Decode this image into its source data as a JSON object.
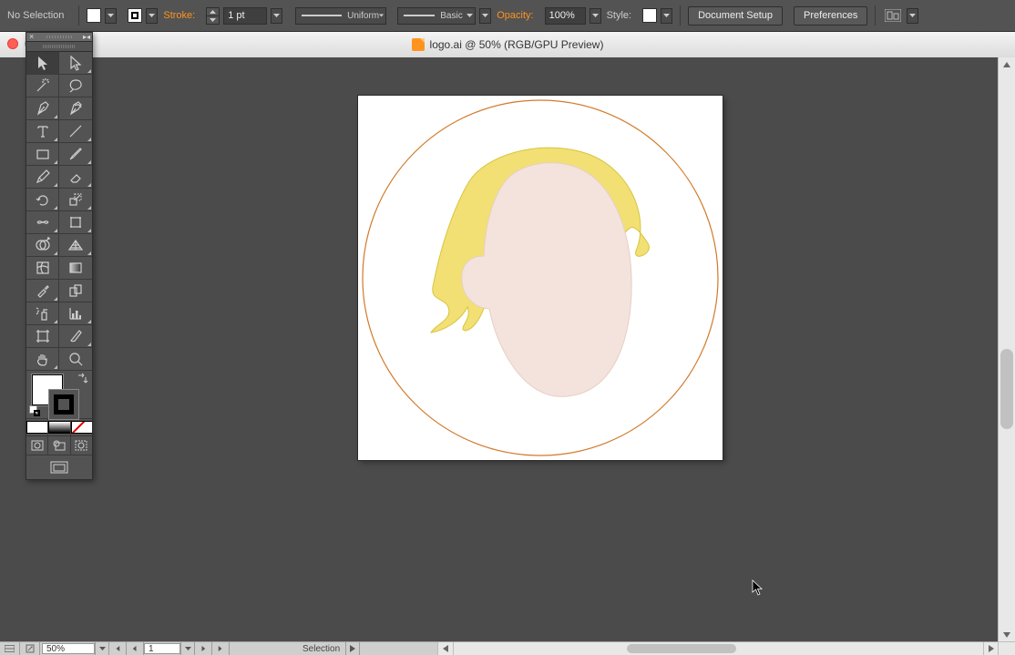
{
  "controlbar": {
    "selection_label": "No Selection",
    "stroke_label": "Stroke:",
    "stroke_weight": "1 pt",
    "variable_width_label": "Uniform",
    "brush_label": "Basic",
    "opacity_label": "Opacity:",
    "opacity_value": "100%",
    "style_label": "Style:",
    "doc_setup_btn": "Document Setup",
    "preferences_btn": "Preferences"
  },
  "document": {
    "title": "logo.ai @ 50% (RGB/GPU Preview)"
  },
  "artwork": {
    "circle_stroke": "#d27a2b",
    "hair_fill": "#f2e074",
    "hair_stroke": "#d8c43e",
    "face_fill": "#f3e3dc",
    "face_stroke": "#e7cfc4"
  },
  "statusbar": {
    "zoom": "50%",
    "artboard": "1",
    "tool": "Selection"
  },
  "tools": {
    "names": [
      "selection-tool",
      "direct-selection-tool",
      "magic-wand-tool",
      "lasso-tool",
      "pen-tool",
      "curvature-tool",
      "type-tool",
      "line-segment-tool",
      "rectangle-tool",
      "paintbrush-tool",
      "pencil-tool",
      "eraser-tool",
      "rotate-tool",
      "scale-tool",
      "width-tool",
      "free-transform-tool",
      "shape-builder-tool",
      "perspective-grid-tool",
      "mesh-tool",
      "gradient-tool",
      "eyedropper-tool",
      "blend-tool",
      "symbol-sprayer-tool",
      "column-graph-tool",
      "artboard-tool",
      "slice-tool",
      "hand-tool",
      "zoom-tool"
    ]
  }
}
